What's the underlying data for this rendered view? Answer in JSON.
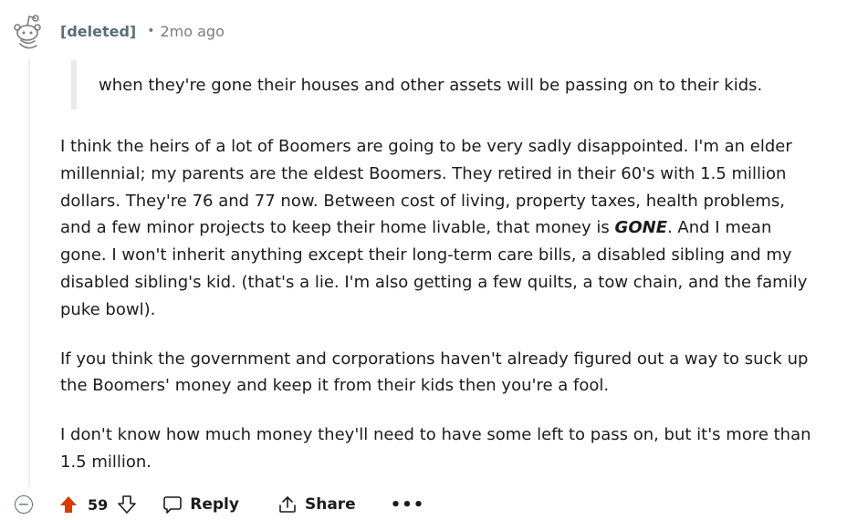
{
  "comment": {
    "author": "[deleted]",
    "separator": "•",
    "time": "2mo ago",
    "quote": "when they're gone their houses and other assets will be passing on to their kids.",
    "paragraphs": {
      "p1_before": "I think the heirs of a lot of Boomers are going to be very sadly disappointed. I'm an elder millennial; my parents are the eldest Boomers. They retired in their 60's with 1.5 million dollars. They're 76 and 77 now. Between cost of living, property taxes, health problems, and a few minor projects to keep their home livable, that money is ",
      "p1_emphasis": "GONE",
      "p1_after": ". And I mean gone. I won't inherit anything except their long-term care bills, a disabled sibling and my disabled sibling's kid. (that's a lie. I'm also getting a few quilts, a tow chain, and the family puke bowl).",
      "p2": "If you think the government and corporations haven't already figured out a way to suck up the Boomers' money and keep it from their kids then you're a fool.",
      "p3": "I don't know how much money they'll need to have some left to pass on, but it's more than 1.5 million."
    }
  },
  "actions": {
    "collapse_glyph": "−",
    "score": "59",
    "reply_label": "Reply",
    "share_label": "Share",
    "more_glyph": "•••"
  },
  "icons": {
    "avatar": "snoo-avatar-icon",
    "upvote": "upvote-arrow-icon",
    "downvote": "downvote-arrow-icon",
    "reply": "speech-bubble-icon",
    "share": "share-icon",
    "more": "ellipsis-icon"
  },
  "colors": {
    "upvote_active": "#d93a00",
    "meta_gray": "#576f76",
    "quote_bar": "#e9e9e9",
    "thread_line": "#edeff1"
  }
}
